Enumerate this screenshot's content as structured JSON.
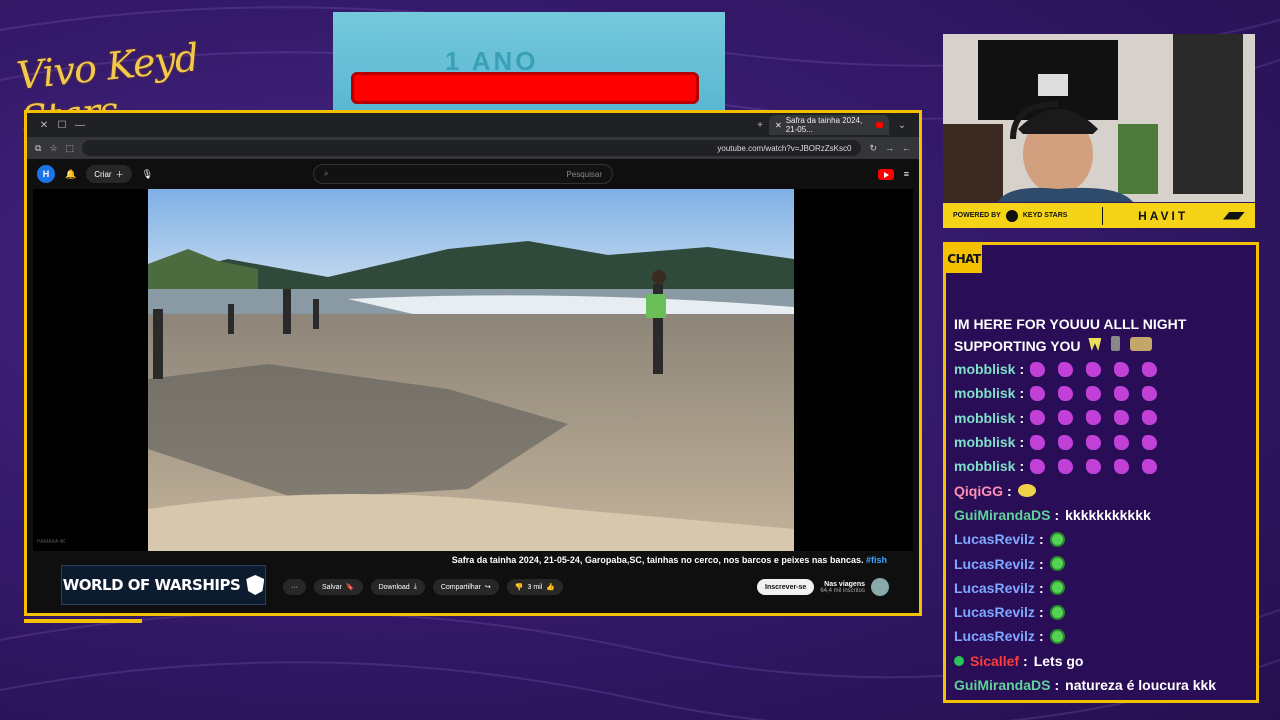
{
  "overlay": {
    "signature_text": "Vivo Keyd Stars",
    "timer_ghost_text": "1 ANO"
  },
  "browser": {
    "tab_title": "Safra da tainha 2024, 21-05...",
    "url": "youtube.com/watch?v=JBORzZsKsc0",
    "search_placeholder": "Pesquisar",
    "create_label": "Criar",
    "avatar_letter": "H"
  },
  "video": {
    "title": "Safra da tainha 2024, 21-05-24, Garopaba,SC, tainhas no cerco, nos barcos e peixes nas bancas.",
    "hashtag": "#fish",
    "channel_name": "Nas viagens",
    "channel_subs": "64,4 mil inscritos",
    "subscribe_label": "Inscrever-se",
    "likes_label": "3 mil",
    "share_label": "Compartilhar",
    "download_label": "Download",
    "save_label": "Salvar",
    "more_label": "···",
    "ad_text": "WORLD OF WARSHIPS",
    "watermark": "HAMARA 4K"
  },
  "sponsor": {
    "powered_by": "POWERED BY",
    "keyd_label": "KEYD STARS",
    "havit_label": "HAVIT"
  },
  "chat": {
    "label": "CHAT",
    "top_message": "IM HERE FOR YOUUU ALLL NIGHT SUPPORTING YOU",
    "messages": [
      {
        "user": "mobblisk",
        "color": "#7ee0c9",
        "text": "",
        "emote": "blob",
        "count": 5
      },
      {
        "user": "mobblisk",
        "color": "#7ee0c9",
        "text": "",
        "emote": "blob",
        "count": 5
      },
      {
        "user": "mobblisk",
        "color": "#7ee0c9",
        "text": "",
        "emote": "blob",
        "count": 5
      },
      {
        "user": "mobblisk",
        "color": "#7ee0c9",
        "text": "",
        "emote": "blob",
        "count": 5
      },
      {
        "user": "mobblisk",
        "color": "#7ee0c9",
        "text": "",
        "emote": "blob",
        "count": 5
      },
      {
        "user": "QiqiGG",
        "color": "#ff8fb3",
        "text": "",
        "emote": "qi",
        "count": 1
      },
      {
        "user": "GuiMirandaDS",
        "color": "#5ed39a",
        "text": "kkkkkkkkkkk",
        "emote": "",
        "count": 0
      },
      {
        "user": "LucasRevilz",
        "color": "#7fa8ff",
        "text": "",
        "emote": "green",
        "count": 1
      },
      {
        "user": "LucasRevilz",
        "color": "#7fa8ff",
        "text": "",
        "emote": "green",
        "count": 1
      },
      {
        "user": "LucasRevilz",
        "color": "#7fa8ff",
        "text": "",
        "emote": "green",
        "count": 1
      },
      {
        "user": "LucasRevilz",
        "color": "#7fa8ff",
        "text": "",
        "emote": "green",
        "count": 1
      },
      {
        "user": "LucasRevilz",
        "color": "#7fa8ff",
        "text": "",
        "emote": "green",
        "count": 1
      },
      {
        "user": "Sicallef",
        "color": "#ff3b3b",
        "text": "Lets go",
        "emote": "",
        "count": 0,
        "badge": true
      },
      {
        "user": "GuiMirandaDS",
        "color": "#5ed39a",
        "text": "natureza é loucura kkk",
        "emote": "",
        "count": 0
      }
    ]
  },
  "colors": {
    "accent": "#f4c000",
    "background": "#351a6b",
    "youtube_red": "#ff0000",
    "chat_bg": "#2a0d57"
  }
}
